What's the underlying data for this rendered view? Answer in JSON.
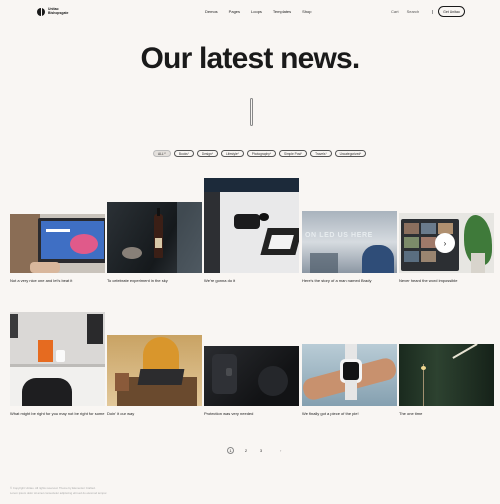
{
  "header": {
    "logo_line1": "Unitao",
    "logo_line2": "Bishopsgate",
    "nav": [
      {
        "label": "Demos",
        "caret": false
      },
      {
        "label": "Pages",
        "caret": true
      },
      {
        "label": "Loops",
        "caret": true
      },
      {
        "label": "Templates",
        "caret": true
      },
      {
        "label": "Shop",
        "caret": true
      }
    ],
    "cart": "Cart",
    "search": "Search",
    "cta": "Get Unitao"
  },
  "hero": {
    "title": "Our latest news."
  },
  "filters": [
    {
      "label": "ALL",
      "count": "17",
      "active": true
    },
    {
      "label": "Books",
      "count": "1",
      "active": false
    },
    {
      "label": "Design",
      "count": "4",
      "active": false
    },
    {
      "label": "Lifestyle",
      "count": "4",
      "active": false
    },
    {
      "label": "Photography",
      "count": "4",
      "active": false
    },
    {
      "label": "Simple Post",
      "count": "1",
      "active": false
    },
    {
      "label": "Travels",
      "count": "1",
      "active": false
    },
    {
      "label": "Uncategorized",
      "count": "4",
      "active": false
    }
  ],
  "posts": [
    {
      "title": "Not a very nice one and let's beat it",
      "image": "laptop-icon"
    },
    {
      "title": "To celebrate experiment in the sky",
      "image": "bottle-icon"
    },
    {
      "title": "We're gonna do it",
      "image": "desk-icon"
    },
    {
      "title": "Here's the story of a man named Brady",
      "image": "typography-icon"
    },
    {
      "title": "Never heard the word impossible",
      "image": "video-call-icon"
    },
    {
      "title": "What might be right for you may not be right for some",
      "image": "office-icon"
    },
    {
      "title": "Doin' it our way",
      "image": "workspace-icon"
    },
    {
      "title": "Protection was very needed",
      "image": "clothing-icon"
    },
    {
      "title": "We finally got a piece of the pie!",
      "image": "watch-icon"
    },
    {
      "title": "The one time",
      "image": "interior-icon"
    }
  ],
  "overlay_text": "ON LED US HERE",
  "pagination": {
    "pages": [
      "1",
      "2",
      "3"
    ],
    "current": "1",
    "next": "›"
  },
  "footer": {
    "line1": "© Copyright Unitao. All rights reserved. Theme by Elementor Crafted.",
    "line2": "Lorem ipsum dolor sit amet consectetur adipiscing elit sed do eiusmod tempor."
  }
}
